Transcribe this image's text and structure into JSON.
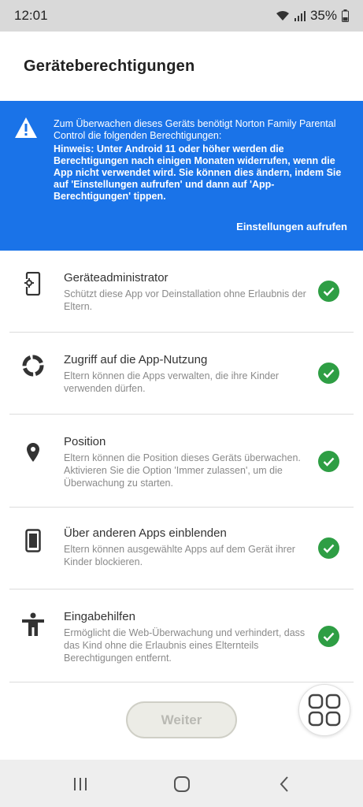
{
  "status_bar": {
    "time": "12:01",
    "battery": "35%",
    "icons": [
      "wifi-icon",
      "signal-icon",
      "battery-icon"
    ]
  },
  "header": {
    "title": "Geräteberechtigungen"
  },
  "banner": {
    "icon": "warning-icon",
    "intro": "Zum Überwachen dieses Geräts benötigt Norton Family Parental Control die folgenden Berechtigungen:",
    "hint": "Hinweis: Unter Android 11 oder höher werden die Berechtigungen nach einigen Monaten widerrufen, wenn die App nicht verwendet wird. Sie können dies ändern, indem Sie auf 'Einstellungen aufrufen' und dann auf 'App-Berechtigungen' tippen.",
    "action_label": "Einstellungen aufrufen",
    "background_color": "#1a73e8"
  },
  "permissions": [
    {
      "icon": "device-admin-icon",
      "title": "Geräteadministrator",
      "description": "Schützt diese App vor Deinstallation ohne Erlaubnis der Eltern.",
      "granted": true
    },
    {
      "icon": "usage-access-icon",
      "title": "Zugriff auf die App-Nutzung",
      "description": "Eltern können die Apps verwalten, die ihre Kinder verwenden dürfen.",
      "granted": true
    },
    {
      "icon": "location-pin-icon",
      "title": "Position",
      "description": "Eltern können die Position dieses Geräts überwachen. Aktivieren Sie die Option 'Immer zulassen', um die Überwachung zu starten.",
      "granted": true
    },
    {
      "icon": "phone-overlay-icon",
      "title": "Über anderen Apps einblenden",
      "description": "Eltern können ausgewählte Apps auf dem Gerät ihrer Kinder blockieren.",
      "granted": true
    },
    {
      "icon": "accessibility-icon",
      "title": "Eingabehilfen",
      "description": "Ermöglicht die Web-Überwachung und verhindert, dass das Kind ohne die Erlaubnis eines Elternteils Berechtigungen entfernt.",
      "granted": true
    }
  ],
  "footer": {
    "next_label": "Weiter",
    "next_enabled": false
  },
  "colors": {
    "accent_blue": "#1a73e8",
    "check_green": "#2e9e44"
  },
  "nav": {
    "buttons": [
      "recent-apps-icon",
      "home-icon",
      "back-icon"
    ]
  }
}
